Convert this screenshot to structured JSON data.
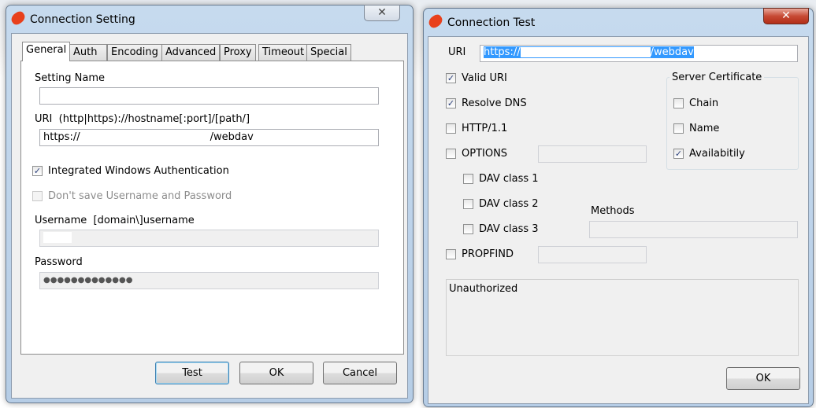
{
  "connection_setting": {
    "title": "Connection Setting",
    "close_label": "✕",
    "tabs": [
      "General",
      "Auth",
      "Encoding",
      "Advanced",
      "Proxy",
      "Timeout",
      "Special"
    ],
    "setting_name_label": "Setting Name",
    "setting_name_value": "",
    "uri_label": "URI  (http|https)://hostname[:port]/[path/]",
    "uri_prefix": "https://",
    "uri_suffix": "/webdav",
    "integrated_auth_label": "Integrated Windows Authentication",
    "integrated_auth_checked": true,
    "dont_save_label": "Don't save Username and Password",
    "dont_save_checked": false,
    "username_label": "Username  [domain\\]username",
    "password_label": "Password",
    "password_value": "●●●●●●●●●●●●●",
    "buttons": {
      "test": "Test",
      "ok": "OK",
      "cancel": "Cancel"
    }
  },
  "connection_test": {
    "title": "Connection Test",
    "close_label": "✕",
    "uri_label": "URI",
    "uri_prefix": "https://",
    "uri_suffix": "/webdav",
    "checks": [
      {
        "label": "Valid URI",
        "checked": true
      },
      {
        "label": "Resolve DNS",
        "checked": true
      },
      {
        "label": "HTTP/1.1",
        "checked": false
      },
      {
        "label": "OPTIONS",
        "checked": false
      },
      {
        "label": "DAV class 1",
        "checked": false
      },
      {
        "label": "DAV class 2",
        "checked": false
      },
      {
        "label": "DAV class 3",
        "checked": false
      },
      {
        "label": "PROPFIND",
        "checked": false
      }
    ],
    "server_certificate": {
      "label": "Server Certificate",
      "checks": [
        {
          "label": "Chain",
          "checked": false
        },
        {
          "label": "Name",
          "checked": false
        },
        {
          "label": "Availabitily",
          "checked": true
        }
      ]
    },
    "methods_label": "Methods",
    "result_text": "Unauthorized",
    "ok_label": "OK"
  }
}
